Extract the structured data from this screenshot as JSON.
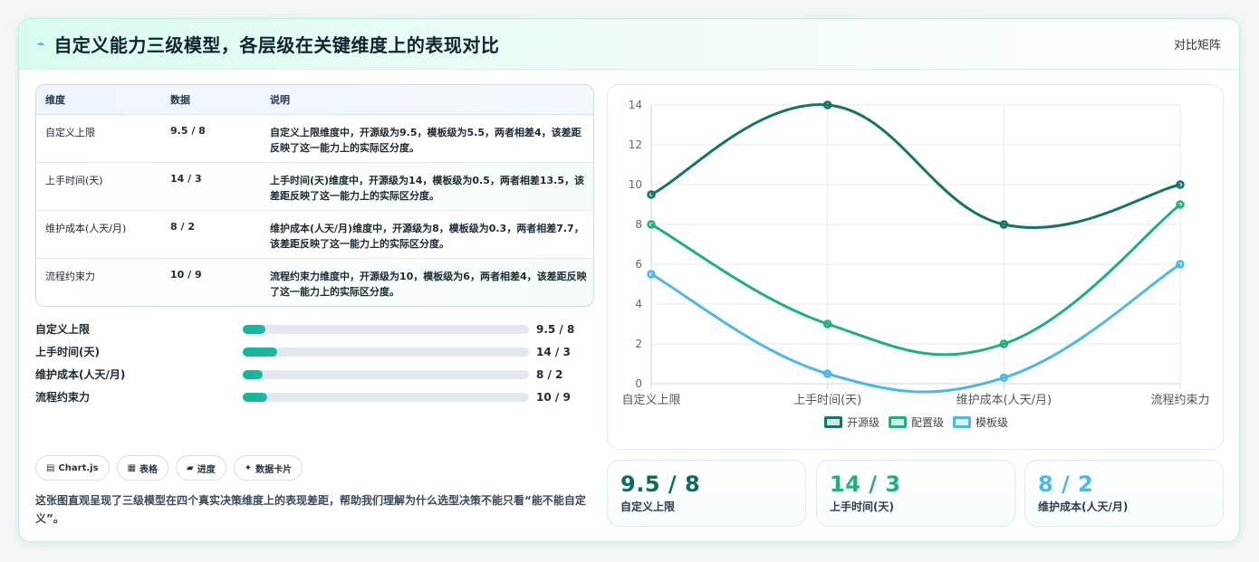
{
  "header": {
    "icon": "bolt-icon",
    "title": "自定义能力三级模型，各层级在关键维度上的表现对比",
    "link": "对比矩阵"
  },
  "table": {
    "columns": [
      "维度",
      "数据",
      "说明"
    ],
    "rows": [
      {
        "dim": "自定义上限",
        "data": "9.5 / 8",
        "desc": "自定义上限维度中，开源级为9.5，模板级为5.5，两者相差4，该差距反映了这一能力上的实际区分度。"
      },
      {
        "dim": "上手时间(天)",
        "data": "14 / 3",
        "desc": "上手时间(天)维度中，开源级为14，模板级为0.5，两者相差13.5，该差距反映了这一能力上的实际区分度。"
      },
      {
        "dim": "维护成本(人天/月)",
        "data": "8 / 2",
        "desc": "维护成本(人天/月)维度中，开源级为8，模板级为0.3，两者相差7.7，该差距反映了这一能力上的实际区分度。"
      },
      {
        "dim": "流程约束力",
        "data": "10 / 9",
        "desc": "流程约束力维度中，开源级为10，模板级为6，两者相差4，该差距反映了这一能力上的实际区分度。"
      }
    ]
  },
  "progress": [
    {
      "label": "自定义上限",
      "value": "9.5 / 8",
      "fill": 0.08
    },
    {
      "label": "上手时间(天)",
      "value": "14 / 3",
      "fill": 0.12
    },
    {
      "label": "维护成本(人天/月)",
      "value": "8 / 2",
      "fill": 0.07
    },
    {
      "label": "流程约束力",
      "value": "10 / 9",
      "fill": 0.085
    }
  ],
  "chips": [
    {
      "icon": "chart-icon",
      "glyph": "▤",
      "label": "Chart.js"
    },
    {
      "icon": "table-icon",
      "glyph": "▦",
      "label": "表格"
    },
    {
      "icon": "progress-icon",
      "glyph": "▰",
      "label": "进度"
    },
    {
      "icon": "sparkle-icon",
      "glyph": "✦",
      "label": "数据卡片"
    }
  ],
  "note": "这张图直观呈现了三级模型在四个真实决策维度上的表现差距，帮助我们理解为什么选型决策不能只看“能不能自定义”。",
  "stats": [
    {
      "value": "9.5 / 8",
      "label": "自定义上限",
      "color": "#0f6b5a"
    },
    {
      "value": "14 / 3",
      "label": "上手时间(天)",
      "color": "#1db27a"
    },
    {
      "value": "8 / 2",
      "label": "维护成本(人天/月)",
      "color": "#4bb8ea"
    }
  ],
  "chart_data": {
    "type": "line",
    "categories": [
      "自定义上限",
      "上手时间(天)",
      "维护成本(人天/月)",
      "流程约束力"
    ],
    "ylim": [
      0,
      14
    ],
    "yticks": [
      0,
      2,
      4,
      6,
      8,
      10,
      12,
      14
    ],
    "grid": true,
    "legend_position": "bottom",
    "series": [
      {
        "name": "开源级",
        "values": [
          9.5,
          14,
          8,
          10
        ],
        "color": "#137565"
      },
      {
        "name": "配置级",
        "values": [
          8,
          3,
          2,
          9
        ],
        "color": "#1db27a"
      },
      {
        "name": "模板级",
        "values": [
          5.5,
          0.5,
          0.3,
          6
        ],
        "color": "#4bb8ea"
      }
    ]
  }
}
